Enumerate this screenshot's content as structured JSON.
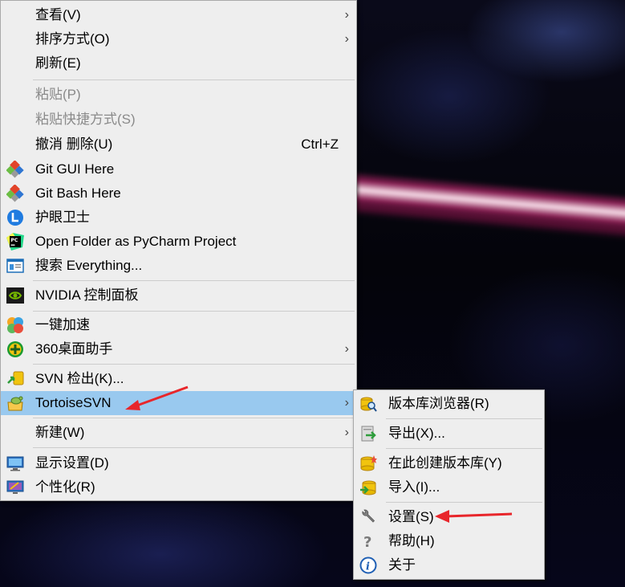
{
  "main_menu": {
    "items": [
      {
        "label": "查看(V)",
        "has_submenu": true
      },
      {
        "label": "排序方式(O)",
        "has_submenu": true
      },
      {
        "label": "刷新(E)"
      },
      {
        "label": "粘贴(P)",
        "disabled": true
      },
      {
        "label": "粘贴快捷方式(S)",
        "disabled": true
      },
      {
        "label": "撤消 删除(U)",
        "shortcut": "Ctrl+Z"
      },
      {
        "label": "Git GUI Here",
        "icon": "git-gui-icon"
      },
      {
        "label": "Git Bash Here",
        "icon": "git-bash-icon"
      },
      {
        "label": "护眼卫士",
        "icon": "eye-guard-icon"
      },
      {
        "label": "Open Folder as PyCharm Project",
        "icon": "pycharm-icon"
      },
      {
        "label": "搜索 Everything...",
        "icon": "everything-search-icon"
      },
      {
        "label": "NVIDIA 控制面板",
        "icon": "nvidia-icon"
      },
      {
        "label": "一键加速",
        "icon": "speedup-icon"
      },
      {
        "label": "360桌面助手",
        "icon": "360-desktop-icon",
        "has_submenu": true
      },
      {
        "label": "SVN 检出(K)...",
        "icon": "svn-checkout-icon"
      },
      {
        "label": "TortoiseSVN",
        "icon": "tortoisesvn-icon",
        "has_submenu": true,
        "highlighted": true
      },
      {
        "label": "新建(W)",
        "has_submenu": true
      },
      {
        "label": "显示设置(D)",
        "icon": "display-settings-icon"
      },
      {
        "label": "个性化(R)",
        "icon": "personalize-icon"
      }
    ],
    "arrow_glyph": "›"
  },
  "tortoise_submenu": {
    "items": [
      {
        "label": "版本库浏览器(R)",
        "icon": "repo-browser-icon"
      },
      {
        "label": "导出(X)...",
        "icon": "export-icon"
      },
      {
        "label": "在此创建版本库(Y)",
        "icon": "create-repo-icon"
      },
      {
        "label": "导入(I)...",
        "icon": "import-icon"
      },
      {
        "label": "设置(S)",
        "icon": "wrench-icon"
      },
      {
        "label": "帮助(H)",
        "icon": "help-icon"
      },
      {
        "label": "关于",
        "icon": "info-icon"
      }
    ]
  },
  "colors": {
    "menu_bg": "#eeeeee",
    "highlight": "#99c9ef",
    "disabled_text": "#8a8a8a",
    "annotation_arrow": "#e8262b"
  }
}
